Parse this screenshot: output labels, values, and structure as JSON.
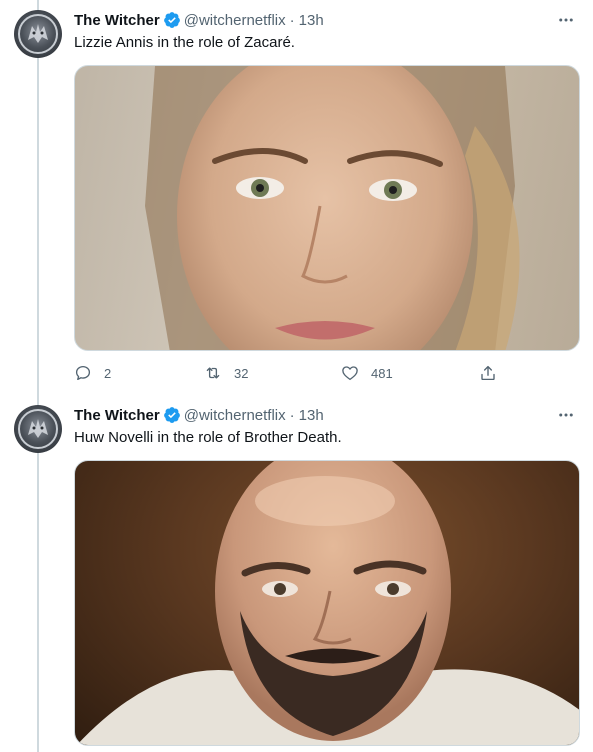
{
  "tweets": [
    {
      "author_name": "The Witcher",
      "handle": "@witchernetflix",
      "separator": "·",
      "time": "13h",
      "text": "Lizzie Annis in the role of Zacaré.",
      "replies": "2",
      "retweets": "32",
      "likes": "481"
    },
    {
      "author_name": "The Witcher",
      "handle": "@witchernetflix",
      "separator": "·",
      "time": "13h",
      "text": "Huw Novelli in the role of Brother Death."
    }
  ],
  "icons": {
    "verified": "verified-badge-icon",
    "more": "more-dots-icon",
    "reply": "reply-icon",
    "retweet": "retweet-icon",
    "like": "heart-icon",
    "share": "share-icon"
  },
  "colors": {
    "verified": "#1d9bf0",
    "secondary_text": "#536471",
    "thread_line": "#cfd9de"
  }
}
